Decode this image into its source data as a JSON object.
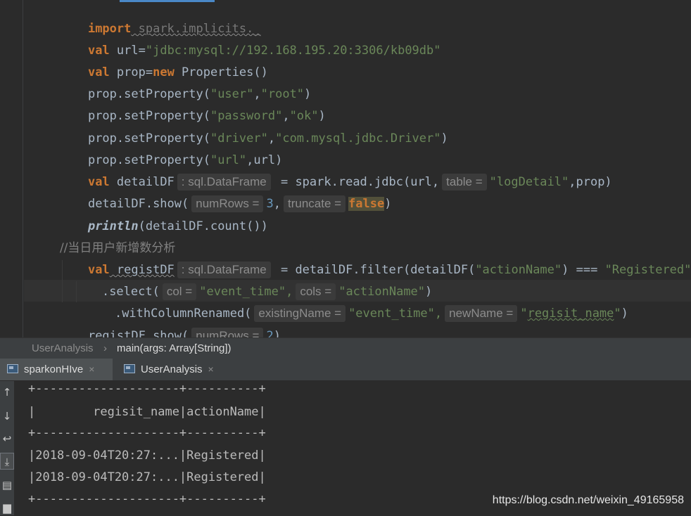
{
  "editor": {
    "lines": {
      "l0": {
        "kw": "import",
        "rest": " spark.implicits._"
      },
      "l1": {
        "kw": "val",
        "name": " url=",
        "str": "\"jdbc:mysql://192.168.195.20:3306/kb09db\""
      },
      "l2": {
        "kw": "val",
        "name": " prop=",
        "kw2": "new",
        "rest": " Properties()"
      },
      "l3": {
        "pre": "prop.setProperty(",
        "s1": "\"user\"",
        "comma": ",",
        "s2": "\"root\"",
        "post": ")"
      },
      "l4": {
        "pre": "prop.setProperty(",
        "s1": "\"password\"",
        "comma": ",",
        "s2": "\"ok\"",
        "post": ")"
      },
      "l5": {
        "pre": "prop.setProperty(",
        "s1": "\"driver\"",
        "comma": ",",
        "s2": "\"com.mysql.jdbc.Driver\"",
        "post": ")"
      },
      "l6": {
        "pre": "prop.setProperty(",
        "s1": "\"url\"",
        "post": ",url)"
      },
      "l7": {
        "kw": "val",
        "name": " detailDF",
        "hint": ": sql.DataFrame",
        "mid": " = spark.read.jdbc(url,",
        "hint2": "table =",
        "s1": "\"logDetail\"",
        "post": ",prop)"
      },
      "l8": {
        "pre": "detailDF.show(",
        "hint1": "numRows =",
        "n": "3",
        "comma": ",",
        "hint2": "truncate =",
        "kwb": "false",
        "post": ")"
      },
      "l9": {
        "fn": "println",
        "post": "(detailDF.count())"
      },
      "l10": {
        "comment": "//当日用户新增数分析"
      },
      "l11": {
        "kw": "val",
        "name": " registDF",
        "hint": ": sql.DataFrame",
        "mid": " = detailDF.filter(detailDF(",
        "s1": "\"actionName\"",
        "mid2": ") === ",
        "s2": "\"Registered\"",
        "post": ")"
      },
      "l12": {
        "pre": ".select(",
        "hint1": "col =",
        "s1": "\"event_time\"",
        "comma": ",",
        "hint2": "cols =",
        "s2": "\"actionName\"",
        "post": ")"
      },
      "l13": {
        "pre": ".withColumnRenamed(",
        "hint1": "existingName =",
        "s1": "\"event_time\"",
        "comma": ",",
        "hint2": "newName =",
        "s2a": "\"",
        "s2b": "regisit_name",
        "s2c": "\"",
        "post": ")"
      },
      "l14": {
        "pre": "registDF.show(",
        "hint1": "numRows =",
        "n": "2",
        "post": ")"
      }
    }
  },
  "breadcrumb": {
    "item1": "UserAnalysis",
    "separator": "›",
    "item2": "main(args: Array[String])"
  },
  "run_tabs": [
    {
      "label": "sparkonHIve",
      "close": "×"
    },
    {
      "label": "UserAnalysis",
      "close": "×"
    }
  ],
  "console": {
    "lines": [
      "+--------------------+----------+",
      "|        regisit_name|actionName|",
      "+--------------------+----------+",
      "|2018-09-04T20:27:...|Registered|",
      "|2018-09-04T20:27:...|Registered|",
      "+--------------------+----------+"
    ]
  },
  "tool_strip": {
    "icons": [
      "up-arrow-icon",
      "down-arrow-icon",
      "soft-wrap-icon",
      "scroll-to-end-icon",
      "print-icon",
      "trash-icon"
    ]
  },
  "watermark": "https://blog.csdn.net/weixin_49165958",
  "colors": {
    "keyword": "#cc7832",
    "string": "#6a8759",
    "number": "#6897bb",
    "background": "#2b2b2b",
    "accent": "#4a88c7"
  }
}
